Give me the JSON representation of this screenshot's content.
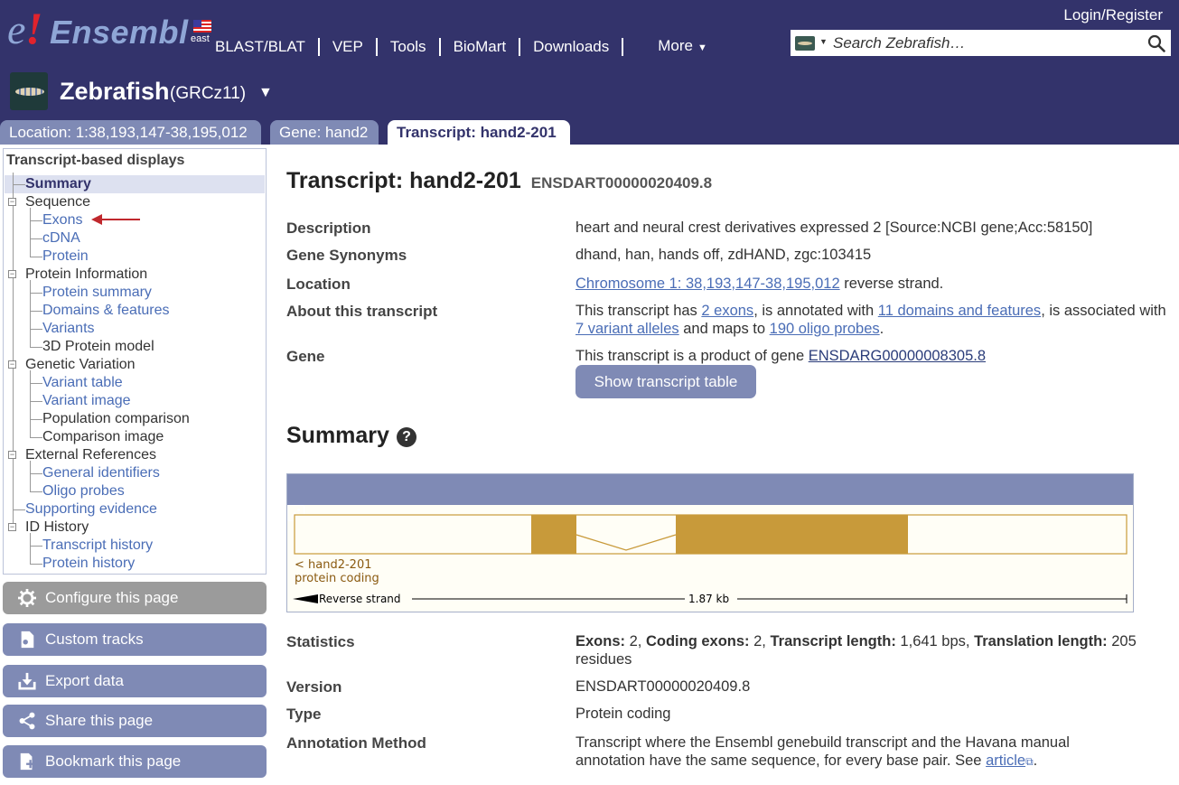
{
  "header": {
    "logo_e": "e",
    "logo_bang": "!",
    "logo_word": "Ensembl",
    "logo_region": "east",
    "login": "Login/Register",
    "nav": [
      "BLAST/BLAT",
      "VEP",
      "Tools",
      "BioMart",
      "Downloads"
    ],
    "more": "More",
    "search_placeholder": "Search Zebrafish…",
    "species_name": "Zebrafish",
    "species_assembly": "(GRCz11)",
    "tabs": [
      "Location: 1:38,193,147-38,195,012",
      "Gene: hand2",
      "Transcript: hand2-201"
    ]
  },
  "sidebar": {
    "heading": "Transcript-based displays",
    "items": [
      "Summary",
      "Sequence",
      "Exons",
      "cDNA",
      "Protein",
      "Protein Information",
      "Protein summary",
      "Domains & features",
      "Variants",
      "3D Protein model",
      "Genetic Variation",
      "Variant table",
      "Variant image",
      "Population comparison",
      "Comparison image",
      "External References",
      "General identifiers",
      "Oligo probes",
      "Supporting evidence",
      "ID History",
      "Transcript history",
      "Protein history"
    ],
    "actions": [
      "Configure this page",
      "Custom tracks",
      "Export data",
      "Share this page",
      "Bookmark this page"
    ]
  },
  "main": {
    "title": "Transcript: hand2-201",
    "title_id": "ENSDART00000020409.8",
    "description_label": "Description",
    "description": "heart and neural crest derivatives expressed 2 [Source:NCBI gene;Acc:58150]",
    "synonyms_label": "Gene Synonyms",
    "synonyms": "dhand, han, hands off, zdHAND, zgc:103415",
    "location_label": "Location",
    "location_link": "Chromosome 1: 38,193,147-38,195,012",
    "location_suffix": " reverse strand.",
    "about_label": "About this transcript",
    "about_t1": "This transcript has ",
    "about_l1": "2 exons",
    "about_t2": ", is annotated with ",
    "about_l2": "11 domains and features",
    "about_t3": ", is associated with ",
    "about_l3": "7 variant alleles",
    "about_t4": " and maps to ",
    "about_l4": "190 oligo probes",
    "about_t5": ".",
    "gene_label": "Gene",
    "gene_text": "This transcript is a product of gene ",
    "gene_link": "ENSDARG00000008305.8",
    "show_table": "Show transcript table",
    "summary_heading": "Summary",
    "help": "?",
    "image": {
      "transcript_label": "< hand2-201",
      "biotype_label": "protein coding",
      "strand_label": "Reverse strand",
      "scale_label": "1.87 kb",
      "exon_color": "#c89a3a"
    },
    "statistics_label": "Statistics",
    "stat_exons_k": "Exons:",
    "stat_exons_v": " 2, ",
    "stat_coding_k": "Coding exons:",
    "stat_coding_v": " 2, ",
    "stat_tlen_k": "Transcript length:",
    "stat_tlen_v": " 1,641 bps, ",
    "stat_trans_k": "Translation length:",
    "stat_trans_v": " 205 residues",
    "version_label": "Version",
    "version": "ENSDART00000020409.8",
    "type_label": "Type",
    "type": "Protein coding",
    "annotation_label": "Annotation Method",
    "annotation_text": "Transcript where the Ensembl genebuild transcript and the Havana manual annotation have the same sequence, for every base pair. See ",
    "annotation_link": "article",
    "annotation_end": "."
  },
  "colors": {
    "masthead": "#33336b",
    "tab": "#7f8ab5",
    "link": "#4a6db6",
    "arrow": "#c0282d"
  }
}
